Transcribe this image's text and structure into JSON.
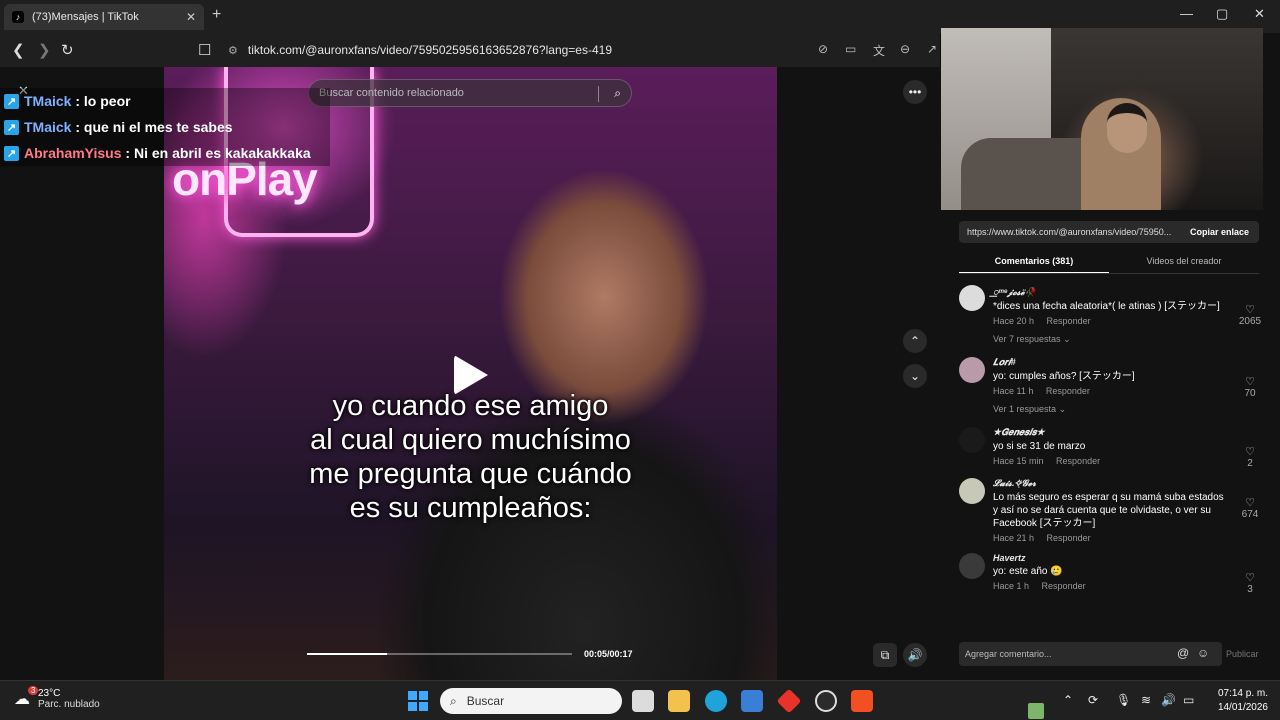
{
  "browser": {
    "tab_title": "(73)Mensajes | TikTok",
    "tab_close": "✕",
    "new_tab": "+",
    "url": "tiktok.com/@auronxfans/video/7595025956163652876?lang=es-419"
  },
  "video": {
    "search_placeholder": "Buscar contenido relacionado",
    "neon_text": "onPlay",
    "caption_lines": [
      "yo cuando ese amigo",
      "al cual quiero muchísimo",
      "me pregunta que cuándo",
      "es su cumpleaños:"
    ],
    "time": "00:05/00:17",
    "progress_fraction": 0.3
  },
  "chat_overlay": [
    {
      "user": "TMaick",
      "message": ": lo peor",
      "color": "#7fb0ff"
    },
    {
      "user": "TMaick",
      "message": ": que ni el mes te sabes",
      "color": "#7fb0ff"
    },
    {
      "user": "AbrahamYisus",
      "message": ": Ni en abril es kakakakkaka",
      "color": "#ff7a8a"
    }
  ],
  "panel": {
    "share_link": "https://www.tiktok.com/@auronxfans/video/75950...",
    "copy_label": "Copiar enlace",
    "tab_comments": "Comentarios (381)",
    "tab_creator": "Videos del creador",
    "comment_placeholder": "Agregar comentario...",
    "publish_label": "Publicar",
    "comments": [
      {
        "user": "꯭ᵐᵉ𝓳𝓸𝓼𝓮̈🥀",
        "text": "*dices una fecha aleatoria*( le atinas ) [ステッカー]",
        "time": "Hace 20 h",
        "reply": "Responder",
        "likes": "2065",
        "replies": "Ver 7 respuestas",
        "avatar": "#dcdcdc"
      },
      {
        "user": "𝑳𝒐𝒓𝒊#",
        "text": "yo: cumples años? [ステッカー]",
        "time": "Hace 11 h",
        "reply": "Responder",
        "likes": "70",
        "replies": "Ver 1 respuesta",
        "avatar": "#b89aa8"
      },
      {
        "user": "★𝑮𝒆𝒏𝒆𝒔𝒊𝒔★",
        "text": "yo si se 31 de marzo",
        "time": "Hace 15 min",
        "reply": "Responder",
        "likes": "2",
        "replies": "",
        "avatar": "#1a1a1a"
      },
      {
        "user": "𝓛𝓾𝓲𝓼.✧̣̇𝓖𝓮𝓻",
        "text": "Lo más seguro es esperar q su mamá suba estados y así no se dará cuenta que te olvidaste, o ver su Facebook [ステッカー]",
        "time": "Hace 21 h",
        "reply": "Responder",
        "likes": "674",
        "replies": "",
        "avatar": "#c8c8b8"
      },
      {
        "user": "Havertz",
        "text": "yo: este año 🥲",
        "time": "Hace 1 h",
        "reply": "Responder",
        "likes": "3",
        "replies": "",
        "avatar": "#3a3a3a"
      }
    ]
  },
  "taskbar": {
    "temp": "23°C",
    "condition": "Parc. nublado",
    "weather_badge": "3",
    "search_label": "Buscar",
    "time": "07:14 p. m.",
    "date": "14/01/2026"
  }
}
